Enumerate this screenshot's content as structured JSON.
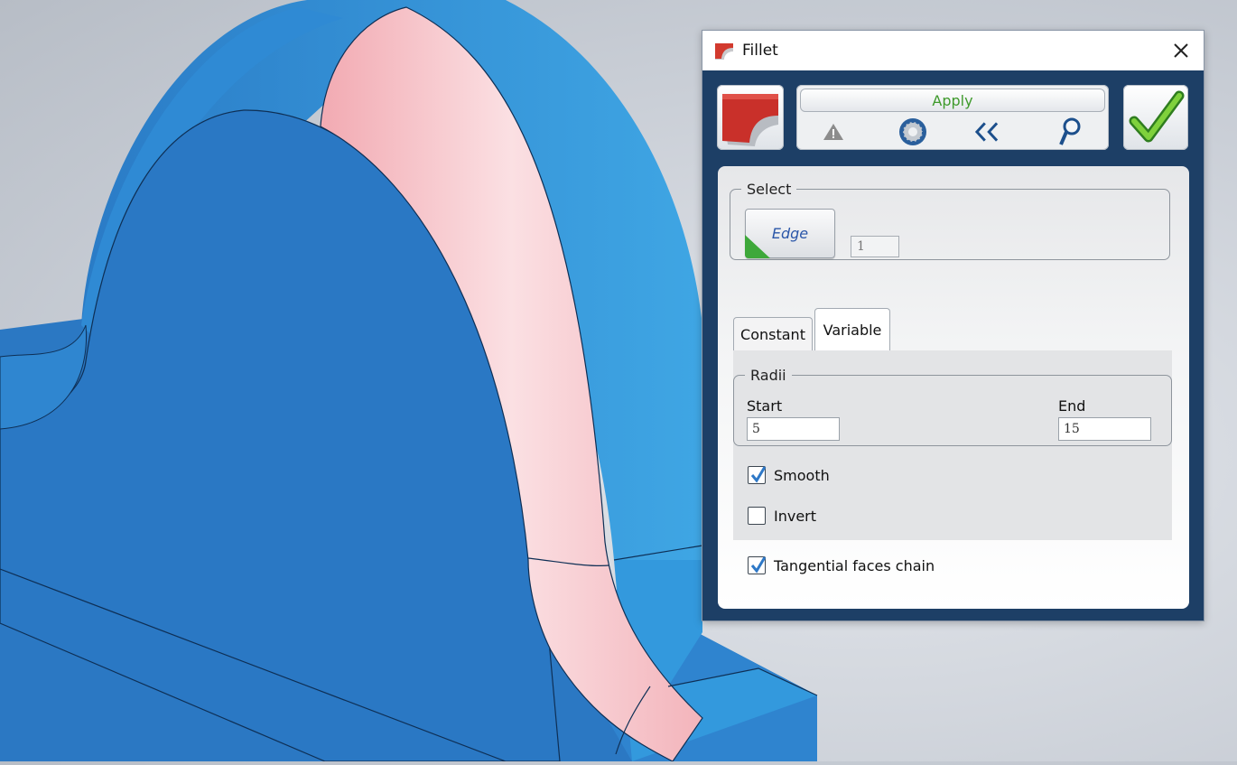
{
  "dialog": {
    "title": "Fillet",
    "apply_label": "Apply",
    "toolbar_icons": [
      "warning-icon",
      "settings-gear-icon",
      "double-chevron-left-icon",
      "magnifier-icon"
    ],
    "select": {
      "legend": "Select",
      "edge_button_label": "Edge",
      "edge_count": "1"
    },
    "tabs": [
      {
        "label": "Constant",
        "active": false
      },
      {
        "label": "Variable",
        "active": true
      }
    ],
    "radii": {
      "legend": "Radii",
      "start_label": "Start",
      "start_value": "5",
      "end_label": "End",
      "end_value": "15"
    },
    "options": {
      "smooth_label": "Smooth",
      "smooth_checked": true,
      "invert_label": "Invert",
      "invert_checked": false,
      "tangential_label": "Tangential faces chain",
      "tangential_checked": true
    }
  },
  "colors": {
    "part_blue": "#2d7cc6",
    "fillet_pink": "#f6c6cc",
    "dialog_frame": "#1d3f66",
    "apply_green": "#3f9a2c",
    "check_blue": "#2e78c7"
  }
}
